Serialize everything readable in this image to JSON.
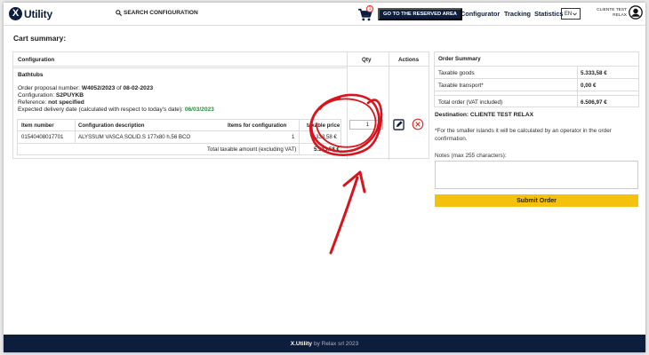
{
  "header": {
    "brand": "Utility",
    "brand_mark": "X",
    "search_label": "SEARCH CONFIGURATION",
    "cart_count": "1",
    "reserved_button": "GO TO THE RESERVED AREA",
    "nav": [
      "Configurator",
      "Tracking",
      "Statistics"
    ],
    "language": "EN",
    "user_line1": "CLIENTE TEST",
    "user_line2": "RELAX"
  },
  "page_title": "Cart summary:",
  "cart_table": {
    "headers": {
      "configuration": "Configuration",
      "qty": "Qty",
      "actions": "Actions"
    },
    "config_name": "Bathtubs",
    "proposal_prefix": "Order proposal number:",
    "proposal_number": "W4052/2023",
    "proposal_of": "of",
    "proposal_date": "08-02-2023",
    "configuration_label": "Configuration:",
    "configuration_code": "S2PUYKB",
    "reference_label": "Reference:",
    "reference_value": "not specified",
    "delivery_label": "Expected delivery date (calculated with respect to today's date):",
    "delivery_date": "06/03/2023",
    "qty_value": "1",
    "items": {
      "headers": [
        "Item number",
        "Configuration description",
        "Items for configuration",
        "taxable price"
      ],
      "rows": [
        {
          "item_number": "01540408017701",
          "description": "ALYSSUM VASCA SOLID.S 177x80 h.56 BCO",
          "items": "1",
          "price": "5.333,58 €"
        }
      ],
      "total_label": "Total taxable amount (excluding VAT)",
      "total_value": "5.333,58 €"
    }
  },
  "summary": {
    "title": "Order Summary",
    "taxable_goods_label": "Taxable goods",
    "taxable_goods_value": "5.333,58 €",
    "transport_label": "Taxable transport*",
    "transport_value": "0,00 €",
    "total_label": "Total order (VAT included)",
    "total_value": "6.506,97 €",
    "destination": "Destination: CLIENTE TEST RELAX",
    "islands_note": "*For the smaller islands it will be calculated by an operator in the order confirmation.",
    "notes_label": "Notes (max 255 characters):",
    "submit": "Submit Order"
  },
  "footer": {
    "brand": "X.Utility",
    "by": "by Relax srl 2023"
  },
  "colors": {
    "navy": "#0d1d3c",
    "yellow": "#f4c20d",
    "annotation_red": "#d9141c",
    "delivery_green": "#2b8a3e",
    "delete_red": "#e22a2a"
  }
}
